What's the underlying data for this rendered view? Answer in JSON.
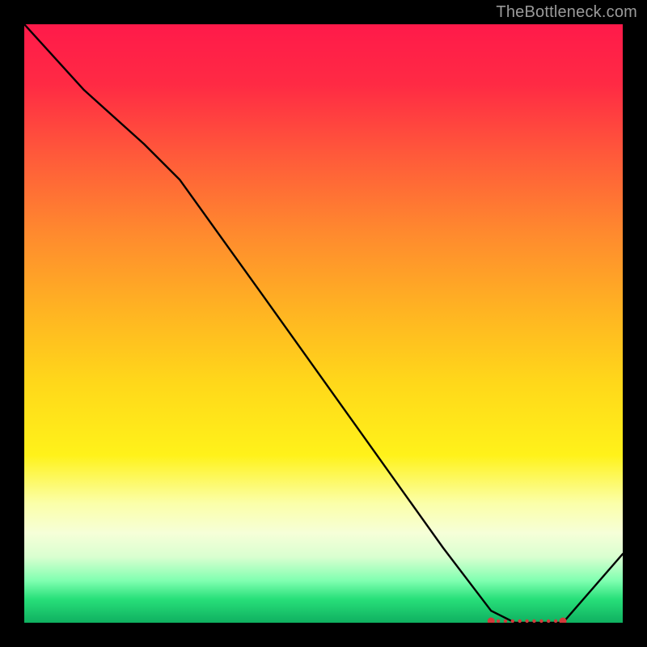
{
  "watermark": "TheBottleneck.com",
  "chart_data": {
    "type": "line",
    "title": "",
    "xlabel": "",
    "ylabel": "",
    "x": [
      0.0,
      0.1,
      0.2,
      0.26,
      0.4,
      0.55,
      0.7,
      0.78,
      0.82,
      0.86,
      0.9,
      1.0
    ],
    "values": [
      1.0,
      0.89,
      0.8,
      0.74,
      0.545,
      0.335,
      0.125,
      0.02,
      0.0,
      0.0,
      0.0,
      0.115
    ],
    "xlim": [
      0,
      1
    ],
    "ylim": [
      0,
      1
    ],
    "marker_range_x": [
      0.78,
      0.9
    ],
    "annotations": []
  }
}
